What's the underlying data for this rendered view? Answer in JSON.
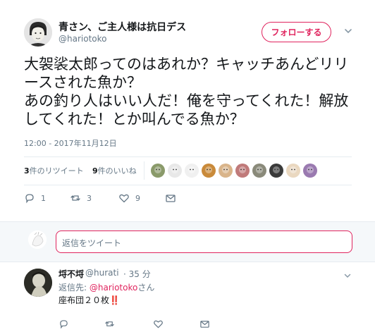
{
  "tweet": {
    "display_name": "青さン、ご主人様は抗日デス",
    "screen_name": "@hariotoko",
    "follow_label": "フォローする",
    "text": "大袈裟太郎ってのはあれか？キャッチあんどリリースされた魚か？\nあの釣り人はいい人だ！俺を守ってくれた！解放してくれた！とか叫んでる魚か？",
    "timestamp": "12:00 - 2017年11月12日",
    "retweets_count": "3",
    "retweets_label": "件のリツイート",
    "likes_count": "9",
    "likes_label": "件のいいね",
    "actions": {
      "reply_count": "1",
      "retweet_count": "3",
      "like_count": "9"
    }
  },
  "likers": [
    {
      "icon": "liker-avatar-1",
      "color": "#8a9a6a"
    },
    {
      "icon": "liker-avatar-2",
      "color": "#e8e8e8"
    },
    {
      "icon": "liker-avatar-3",
      "color": "#f0f0f0"
    },
    {
      "icon": "liker-avatar-4",
      "color": "#c98a3a"
    },
    {
      "icon": "liker-avatar-5",
      "color": "#d9b48a"
    },
    {
      "icon": "liker-avatar-6",
      "color": "#c07a7a"
    },
    {
      "icon": "liker-avatar-7",
      "color": "#8a8a7a"
    },
    {
      "icon": "liker-avatar-8",
      "color": "#3a3a3a"
    },
    {
      "icon": "liker-avatar-9",
      "color": "#ead8c0"
    },
    {
      "icon": "liker-avatar-10",
      "color": "#9a7ab0"
    }
  ],
  "reply_box": {
    "placeholder": "返信をツイート"
  },
  "reply": {
    "name": "埒不埒",
    "handle": "@hurati",
    "time": "· 35 分",
    "replying_prefix": "返信先: ",
    "replying_to": "@hariotoko",
    "replying_suffix": "さん",
    "text": "座布団２０枚",
    "emphasis": "‼️"
  },
  "colors": {
    "accent": "#e0245e",
    "secondary_text": "#657786",
    "divider": "#e6ecf0"
  }
}
